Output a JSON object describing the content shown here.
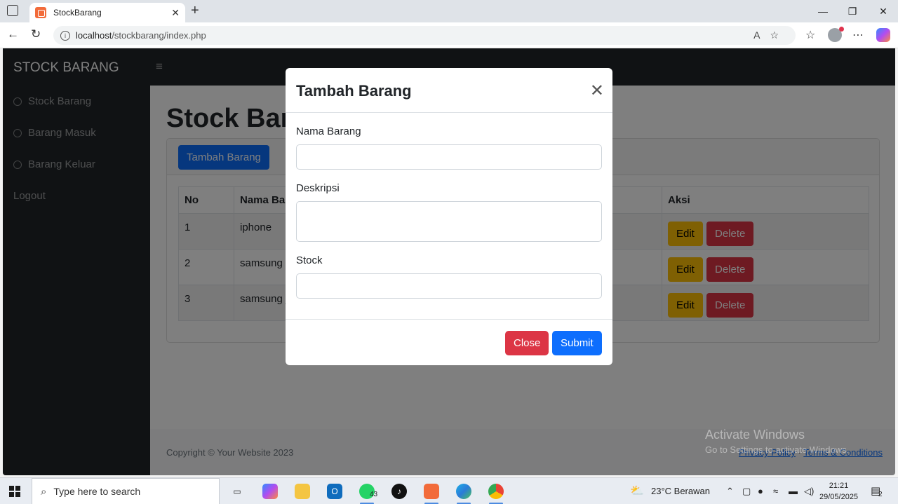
{
  "browser": {
    "tab_title": "StockBarang",
    "tab_close": "✕",
    "new_tab": "+",
    "url_host": "localhost",
    "url_path": "/stockbarang/index.php",
    "window_controls": [
      "—",
      "❐",
      "✕"
    ]
  },
  "app": {
    "brand": "STOCK BARANG",
    "hamburger": "≡",
    "sidebar": [
      {
        "label": "Stock Barang"
      },
      {
        "label": "Barang Masuk"
      },
      {
        "label": "Barang Keluar"
      },
      {
        "label": "Logout"
      }
    ],
    "page_title": "Stock Barang",
    "add_button": "Tambah Barang",
    "table": {
      "headers": [
        "No",
        "Nama Barang",
        "Aksi"
      ],
      "rows": [
        {
          "no": "1",
          "nama": "iphone"
        },
        {
          "no": "2",
          "nama": "samsung a"
        },
        {
          "no": "3",
          "nama": "samsung j"
        }
      ],
      "edit_label": "Edit",
      "delete_label": "Delete"
    },
    "footer": {
      "copyright": "Copyright © Your Website 2023",
      "privacy": "Privacy Policy",
      "separator": "·",
      "terms": "Terms & Conditions"
    }
  },
  "modal": {
    "title": "Tambah Barang",
    "close_x": "✕",
    "fields": [
      {
        "label": "Nama Barang",
        "value": ""
      },
      {
        "label": "Deskripsi",
        "value": ""
      },
      {
        "label": "Stock",
        "value": ""
      }
    ],
    "close_button": "Close",
    "submit_button": "Submit"
  },
  "watermark": {
    "line1": "Activate Windows",
    "line2": "Go to Settings to activate Windows."
  },
  "taskbar": {
    "search_placeholder": "Type here to search",
    "whatsapp_badge": "43",
    "weather": "23°C  Berawan",
    "time": "21:21",
    "date": "29/05/2025",
    "notif_count": "2"
  }
}
